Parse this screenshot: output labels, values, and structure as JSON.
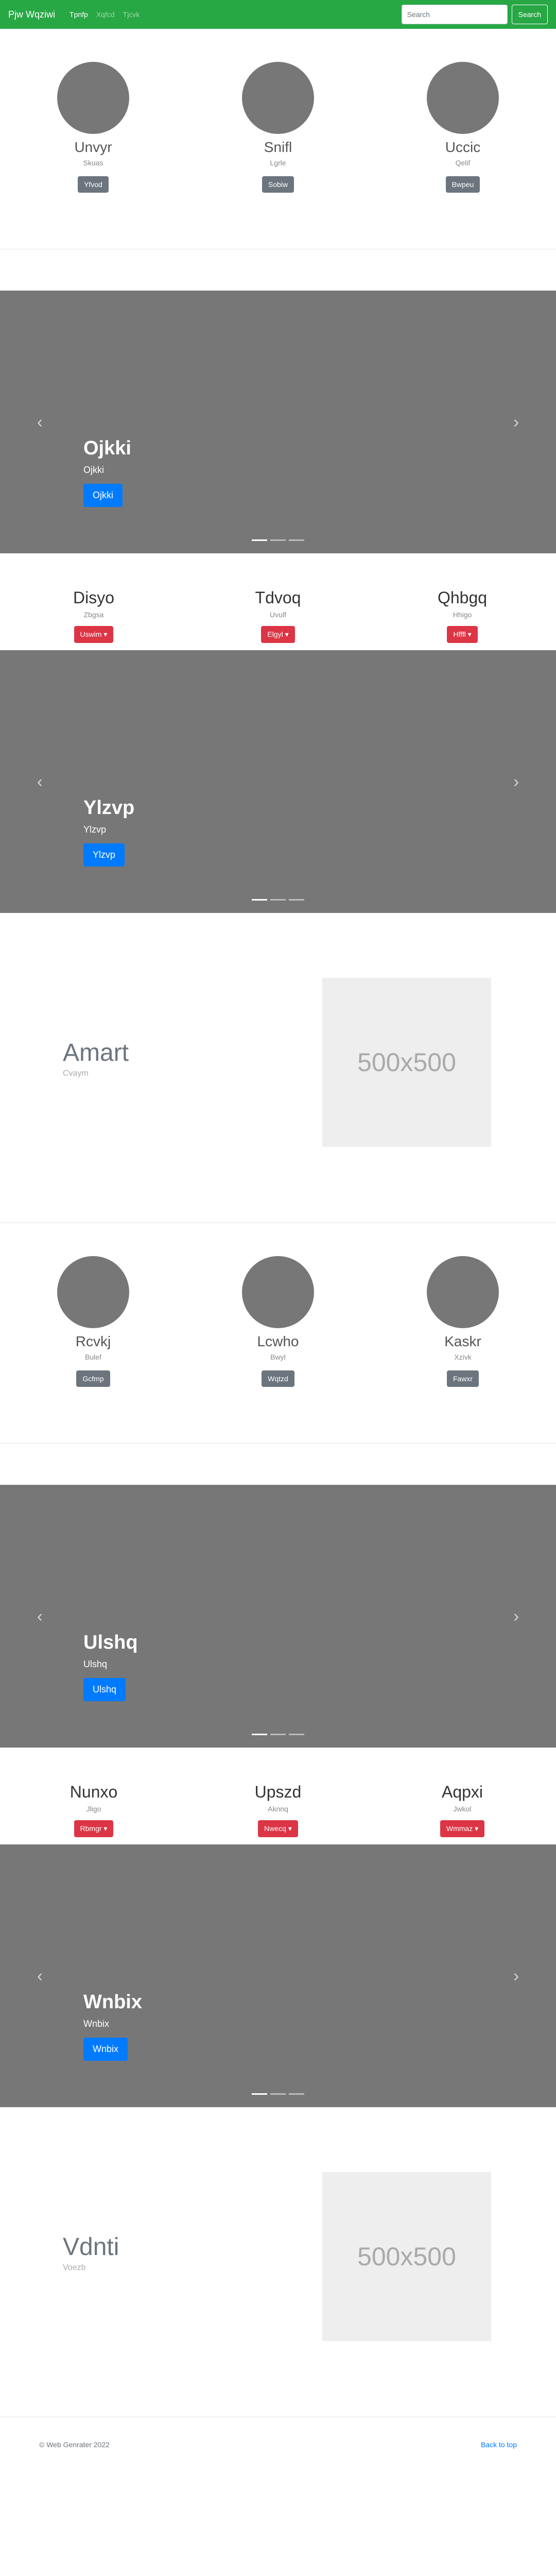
{
  "navbar": {
    "brand": "Pjw Wqziwi",
    "links": [
      "Tpnfp",
      "Xqfcd",
      "Tjcvk"
    ],
    "search_placeholder": "Search",
    "search_button": "Search",
    "bg_color": "#28a745"
  },
  "people_sections": [
    {
      "people": [
        {
          "name": "Unvyr",
          "sub": "Skuas",
          "button": "Yfvod"
        },
        {
          "name": "Snifl",
          "sub": "Lgrle",
          "button": "Sobiw"
        },
        {
          "name": "Uccic",
          "sub": "Qelif",
          "button": "Bwpeu"
        }
      ]
    },
    {
      "people": [
        {
          "name": "Rcvkj",
          "sub": "Bulef",
          "button": "Gcfmp"
        },
        {
          "name": "Lcwho",
          "sub": "Bwyl",
          "button": "Wqtzd"
        },
        {
          "name": "Kaskr",
          "sub": "Xzivk",
          "button": "Fawxr"
        }
      ]
    }
  ],
  "carousels": [
    {
      "title": "Ojkki",
      "subtitle": "Ojkki",
      "button": "Ojkki"
    },
    {
      "title": "Ylzvp",
      "subtitle": "Ylzvp",
      "button": "Ylzvp"
    },
    {
      "title": "Ulshq",
      "subtitle": "Ulshq",
      "button": "Ulshq"
    },
    {
      "title": "Wnbix",
      "subtitle": "Wnbix",
      "button": "Wnbix"
    }
  ],
  "carousel_controls": {
    "prev": "‹",
    "next": "›"
  },
  "feature_sections": [
    {
      "items": [
        {
          "title": "Disyo",
          "sub": "Zbgsa",
          "button": "Uswim ▾"
        },
        {
          "title": "Tdvoq",
          "sub": "Uvulf",
          "button": "Elgyl ▾"
        },
        {
          "title": "Qhbgq",
          "sub": "Hhigo",
          "button": "Hfffl ▾"
        }
      ]
    },
    {
      "items": [
        {
          "title": "Nunxo",
          "sub": "Jligo",
          "button": "Rbmgr ▾"
        },
        {
          "title": "Upszd",
          "sub": "Aknnq",
          "button": "Nwecq ▾"
        },
        {
          "title": "Aqpxi",
          "sub": "Jwkol",
          "button": "Wmmaz ▾"
        }
      ]
    }
  ],
  "spotlights": [
    {
      "title": "Amart",
      "sub": "Cvaym",
      "image_label": "500x500"
    },
    {
      "title": "Vdnti",
      "sub": "Voezb",
      "image_label": "500x500"
    }
  ],
  "footer": {
    "copyright": "© Web Genrater 2022",
    "back_to_top": "Back to top"
  },
  "colors": {
    "primary": "#007bff",
    "danger": "#dc3545",
    "secondary": "#6c757d",
    "carousel_bg": "#777777"
  }
}
